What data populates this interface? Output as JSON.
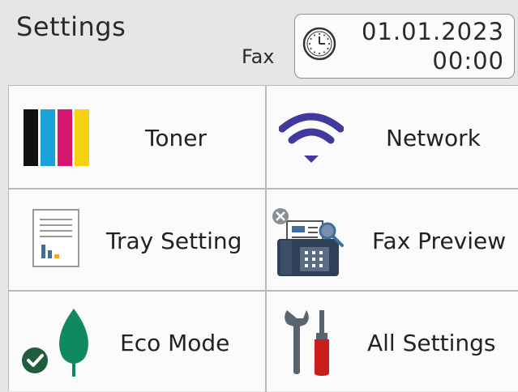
{
  "header": {
    "title": "Settings",
    "mode": "Fax",
    "date": "01.01.2023",
    "time": "00:00",
    "clock_icon": "clock-icon"
  },
  "menu": {
    "items": [
      {
        "label": "Toner",
        "icon": "toner-icon"
      },
      {
        "label": "Network",
        "icon": "wifi-icon"
      },
      {
        "label": "Tray Setting",
        "icon": "tray-setting-icon"
      },
      {
        "label": "Fax Preview",
        "icon": "fax-preview-icon"
      },
      {
        "label": "Eco Mode",
        "icon": "eco-leaf-icon"
      },
      {
        "label": "All Settings",
        "icon": "tools-icon"
      }
    ]
  },
  "colors": {
    "toner": [
      "#111111",
      "#1aa3d9",
      "#d6166e",
      "#f6d10f"
    ],
    "network": "#3f3a9c",
    "eco_leaf": "#0f8a5f",
    "eco_check": "#1f5d3c",
    "tools_handle": "#cc1d1d",
    "tools_metal": "#5a6470"
  }
}
